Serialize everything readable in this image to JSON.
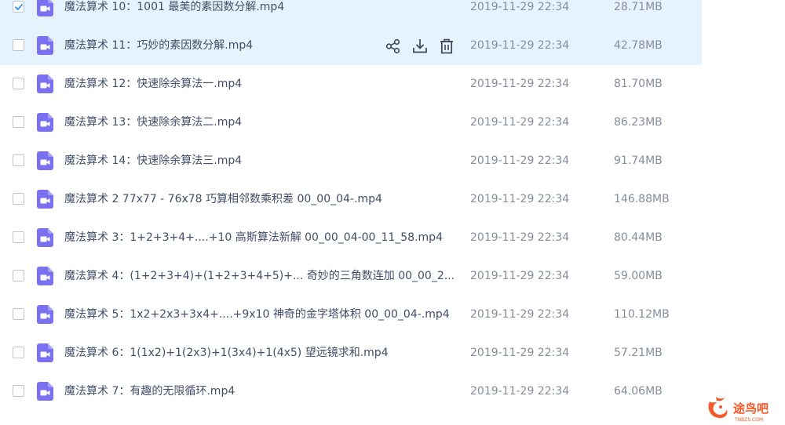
{
  "files": [
    {
      "name": "魔法算术 10：1001  最美的素因数分解.mp4",
      "date": "2019-11-29 22:34",
      "size": "28.71MB",
      "checked": true
    },
    {
      "name": "魔法算术 11：巧妙的素因数分解.mp4",
      "date": "2019-11-29 22:34",
      "size": "42.78MB",
      "checked": false
    },
    {
      "name": "魔法算术 12：快速除余算法一.mp4",
      "date": "2019-11-29 22:34",
      "size": "81.70MB",
      "checked": false
    },
    {
      "name": "魔法算术 13：快速除余算法二.mp4",
      "date": "2019-11-29 22:34",
      "size": "86.23MB",
      "checked": false
    },
    {
      "name": "魔法算术 14：快速除余算法三.mp4",
      "date": "2019-11-29 22:34",
      "size": "91.74MB",
      "checked": false
    },
    {
      "name": "魔法算术 2 77x77 - 76x78  巧算相邻数乘积差 00_00_04-.mp4",
      "date": "2019-11-29 22:34",
      "size": "146.88MB",
      "checked": false
    },
    {
      "name": "魔法算术 3：1+2+3+4+....+10  高斯算法新解 00_00_04-00_11_58.mp4",
      "date": "2019-11-29 22:34",
      "size": "80.44MB",
      "checked": false
    },
    {
      "name": "魔法算术 4：(1+2+3+4)+(1+2+3+4+5)+... 奇妙的三角数连加 00_00_2...",
      "date": "2019-11-29 22:34",
      "size": "59.00MB",
      "checked": false
    },
    {
      "name": "魔法算术 5：1x2+2x3+3x4+....+9x10  神奇的金字塔体积 00_00_04-.mp4",
      "date": "2019-11-29 22:34",
      "size": "110.12MB",
      "checked": false
    },
    {
      "name": "魔法算术 6：1(1x2)+1(2x3)+1(3x4)+1(4x5) 望远镜求和.mp4",
      "date": "2019-11-29 22:34",
      "size": "57.21MB",
      "checked": false
    },
    {
      "name": "魔法算术 7：有趣的无限循环.mp4",
      "date": "2019-11-29 22:34",
      "size": "64.06MB",
      "checked": false
    }
  ],
  "row_actions": {
    "share_icon": "share-icon",
    "download_icon": "download-icon",
    "delete_icon": "delete-icon"
  },
  "watermark": {
    "text": "途鸟吧",
    "subtext": "TNBZS.COM"
  },
  "colors": {
    "highlight_row": "#e6f3fd",
    "video_icon": "#7a70f0",
    "text_primary": "#424e67",
    "text_secondary": "#878c9c",
    "checkbox_checked": "#3b9af6"
  }
}
